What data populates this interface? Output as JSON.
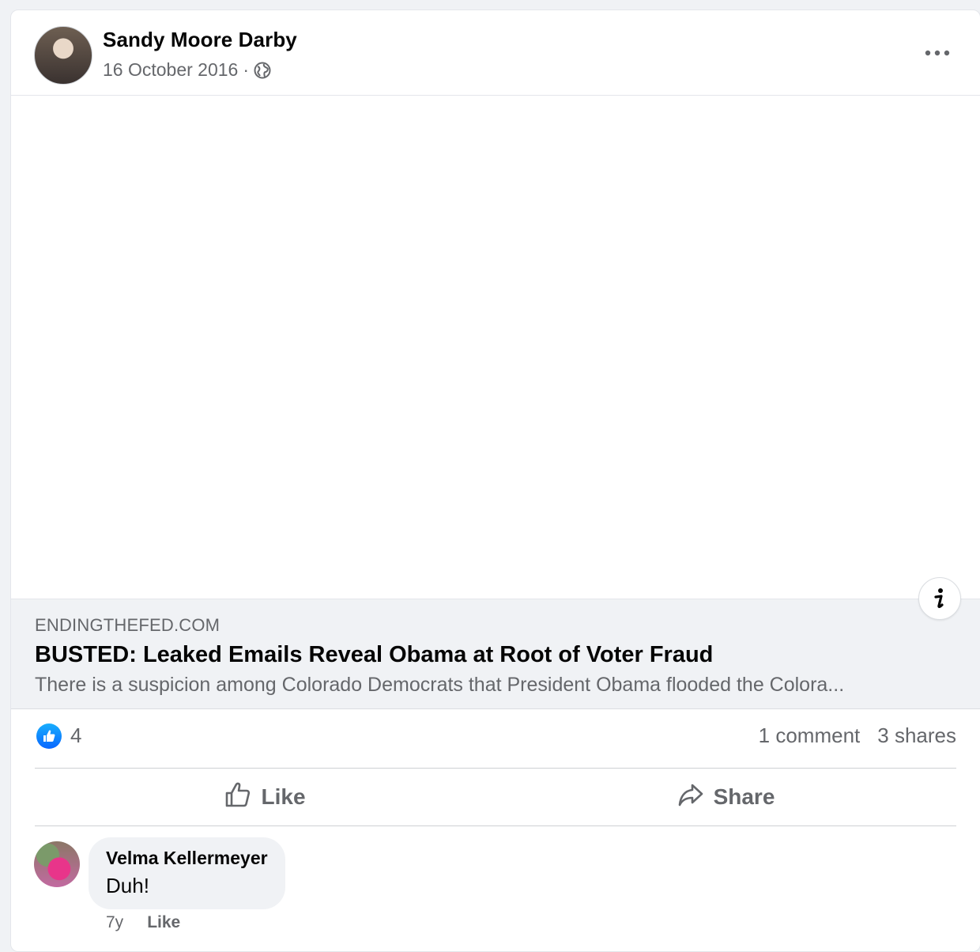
{
  "post": {
    "author": "Sandy Moore Darby",
    "date": "16 October 2016",
    "separator": "·",
    "privacy_icon": "globe-icon",
    "more_icon": "more-horizontal-icon"
  },
  "link_preview": {
    "domain": "ENDINGTHEFED.COM",
    "title": "BUSTED: Leaked Emails Reveal Obama at Root of Voter Fraud",
    "description": "There is a suspicion among Colorado Democrats that President Obama flooded the Colora...",
    "info_icon": "info-icon"
  },
  "stats": {
    "like_count": "4",
    "comments": "1 comment",
    "shares": "3 shares"
  },
  "actions": {
    "like_label": "Like",
    "share_label": "Share"
  },
  "comments": [
    {
      "author": "Velma Kellermeyer",
      "text": "Duh!",
      "age": "7y",
      "like_label": "Like"
    }
  ],
  "colors": {
    "accent": "#0866ff",
    "secondary_text": "#65676b",
    "background": "#f0f2f5"
  }
}
